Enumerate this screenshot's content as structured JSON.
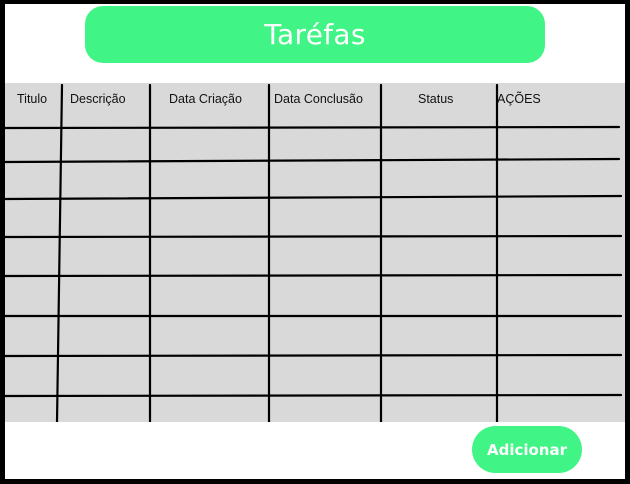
{
  "header": {
    "title": "Taréfas"
  },
  "table": {
    "columns": [
      "Titulo",
      "Descrição",
      "Data Criação",
      "Data Conclusão",
      "Status",
      "AÇÕES"
    ],
    "row_count": 8,
    "rows": []
  },
  "actions": {
    "add_label": "Adicionar"
  },
  "colors": {
    "accent": "#40f585",
    "table_background": "#d9d9d9",
    "frame": "#000000",
    "text_on_accent": "#ffffff"
  }
}
